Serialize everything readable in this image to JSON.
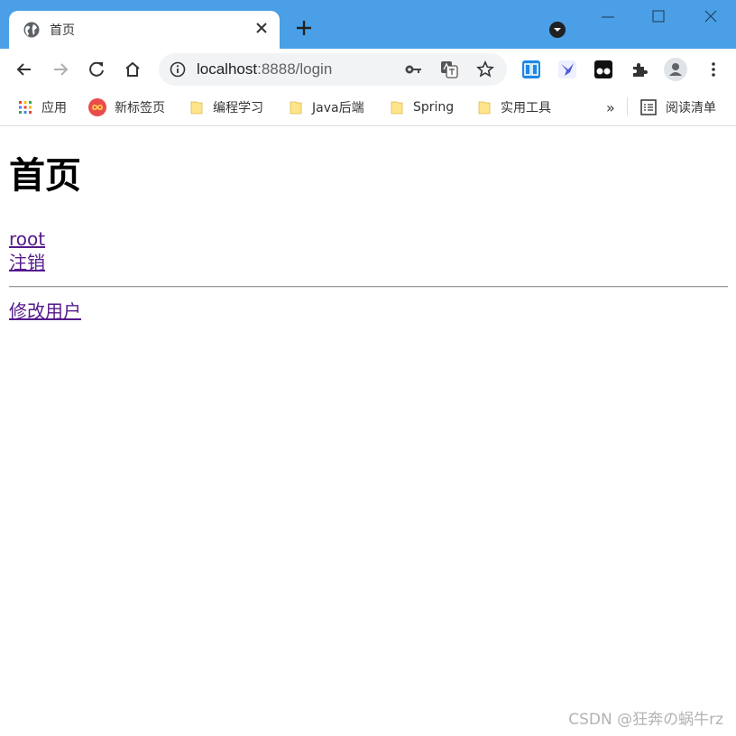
{
  "tab": {
    "title": "首页"
  },
  "address": {
    "host": "localhost",
    "rest": ":8888/login"
  },
  "bookmarks": {
    "items": [
      {
        "label": "应用"
      },
      {
        "label": "新标签页"
      },
      {
        "label": "编程学习"
      },
      {
        "label": "Java后端"
      },
      {
        "label": "Spring"
      },
      {
        "label": "实用工具"
      }
    ],
    "overflow": "»",
    "reading_list": "阅读清单"
  },
  "page": {
    "heading": "首页",
    "user_link": "root",
    "logout_link": "注销",
    "edit_user_link": "修改用户"
  },
  "watermark": "CSDN @狂奔の蜗牛rz",
  "colors": {
    "titlebar": "#4a9fe6",
    "visited_link": "#551a8b",
    "link": "#1a0dab"
  }
}
